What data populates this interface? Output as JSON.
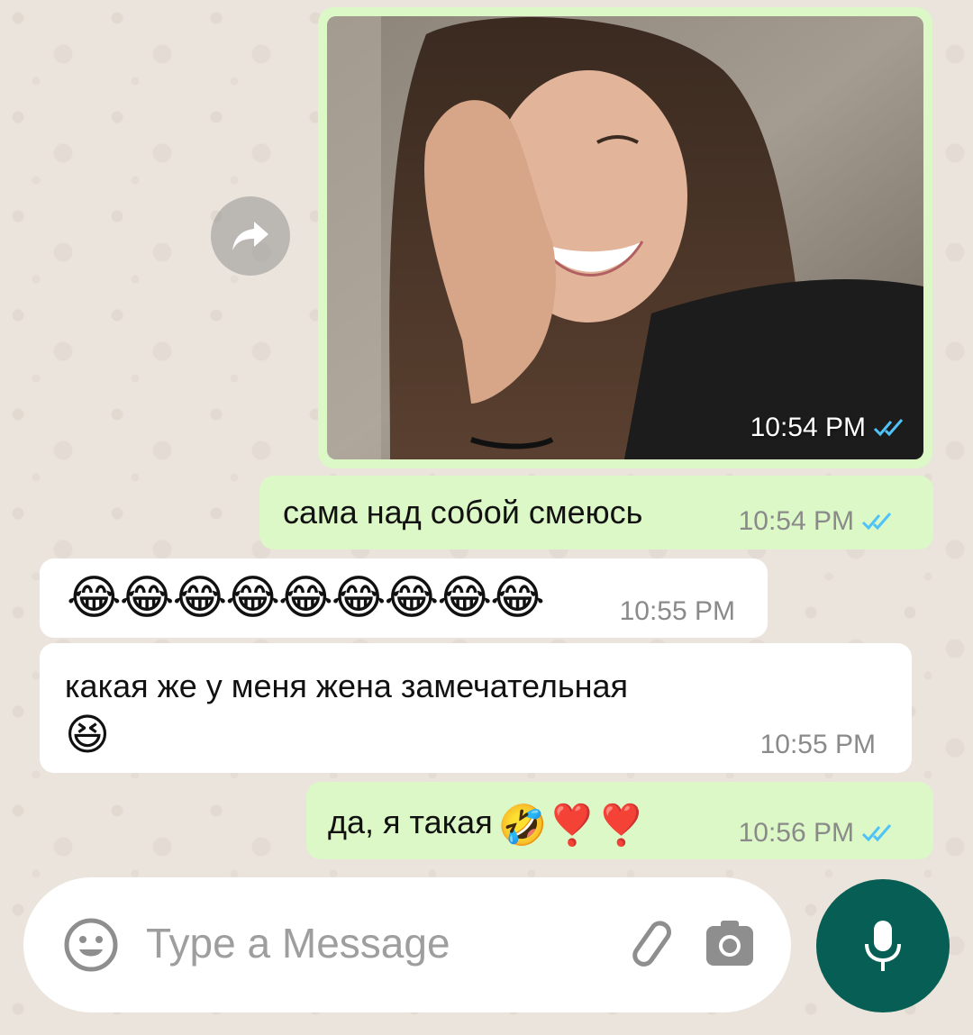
{
  "messages": [
    {
      "kind": "image",
      "direction": "outgoing",
      "time": "10:54 PM",
      "read": true
    },
    {
      "kind": "text",
      "direction": "outgoing",
      "text": "сама над собой смеюсь",
      "time": "10:54 PM",
      "read": true
    },
    {
      "kind": "text",
      "direction": "incoming",
      "text": "😂😂😂😂😂😂😂😂😂",
      "time": "10:55 PM"
    },
    {
      "kind": "text",
      "direction": "incoming",
      "text": "какая же у меня жена замечательная",
      "emoji": "😆",
      "time": "10:55 PM"
    },
    {
      "kind": "text",
      "direction": "outgoing",
      "text": "да, я такая",
      "emoji": "🤣❣️❣️",
      "time": "10:56 PM",
      "read": true
    }
  ],
  "input": {
    "placeholder": "Type a Message"
  },
  "icons": {
    "forward": "forward-icon",
    "read_receipt": "double-check-icon",
    "emoji": "emoji-icon",
    "attach": "paperclip-icon",
    "camera": "camera-icon",
    "mic": "mic-icon"
  },
  "colors": {
    "outgoing_bubble": "#dcf8c6",
    "incoming_bubble": "#ffffff",
    "read_tick": "#4fc3f7",
    "mic_button": "#075e54",
    "wallpaper": "#ebe4dc"
  }
}
